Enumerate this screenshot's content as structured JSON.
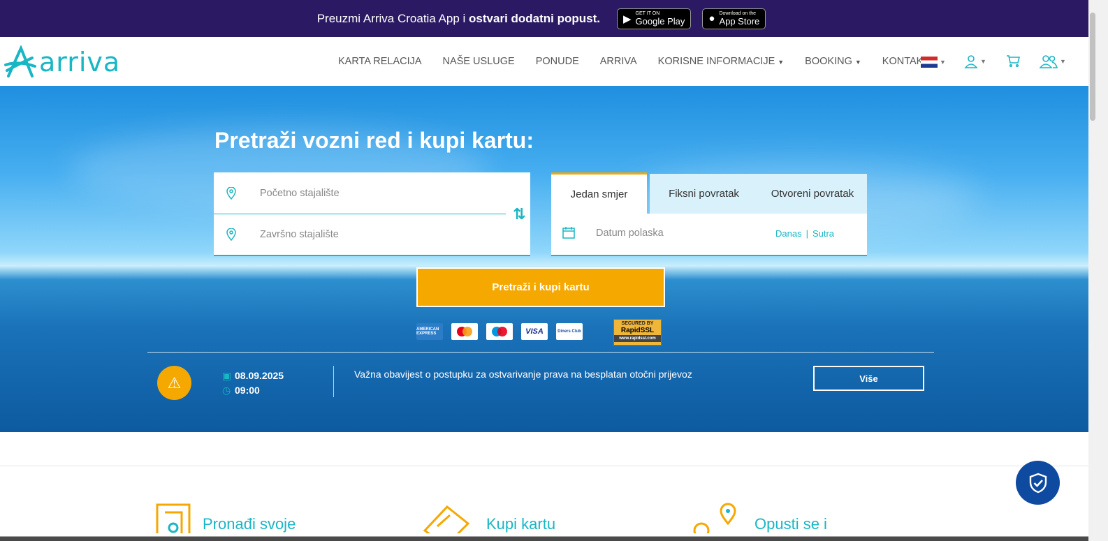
{
  "promo": {
    "text_prefix": "Preuzmi Arriva Croatia App i",
    "text_bold": "ostvari dodatni popust.",
    "google_small": "GET IT ON",
    "google_big": "Google Play",
    "apple_small": "Download on the",
    "apple_big": "App Store"
  },
  "brand": {
    "name": "arriva",
    "accent": "#19b6c4",
    "orange": "#f5a800",
    "navy": "#2b1a63"
  },
  "nav": {
    "items": [
      {
        "label": "KARTA RELACIJA",
        "caret": false
      },
      {
        "label": "NAŠE USLUGE",
        "caret": false
      },
      {
        "label": "PONUDE",
        "caret": false
      },
      {
        "label": "ARRIVA",
        "caret": false
      },
      {
        "label": "KORISNE INFORMACIJE",
        "caret": true
      },
      {
        "label": "BOOKING",
        "caret": true
      },
      {
        "label": "KONTAKT",
        "caret": true
      }
    ],
    "icons": [
      "croatia-flag-icon",
      "user-icon",
      "cart-icon",
      "users-icon"
    ]
  },
  "hero": {
    "title": "Pretraži vozni red i kupi kartu:",
    "from_placeholder": "Početno stajalište",
    "to_placeholder": "Završno stajalište",
    "tabs": [
      "Jedan smjer",
      "Fiksni povratak",
      "Otvoreni povratak"
    ],
    "active_tab": 0,
    "date_placeholder": "Datum polaska",
    "quick_today": "Danas",
    "quick_sep": "|",
    "quick_tomorrow": "Sutra",
    "search_label": "Pretraži i kupi kartu",
    "payment_icons": [
      "amex-icon",
      "mastercard-icon",
      "maestro-icon",
      "visa-icon",
      "diners-club-icon"
    ],
    "card_labels": {
      "amex": "AMERICAN EXPRESS",
      "visa": "VISA",
      "diners": "Diners Club"
    },
    "ssl": {
      "line1": "SECURED BY",
      "line2": "RapidSSL",
      "line3": "www.rapidssl.com"
    }
  },
  "notice": {
    "date": "08.09.2025",
    "time": "09:00",
    "text": "Važna obavijest o postupku za ostvarivanje prava na besplatan otočni prijevoz",
    "more_label": "Više"
  },
  "features": [
    {
      "title": "Pronađi svoje",
      "icon": "map-icon"
    },
    {
      "title": "Kupi kartu",
      "icon": "ticket-icon"
    },
    {
      "title": "Opusti se i",
      "icon": "route-pin-icon"
    }
  ]
}
